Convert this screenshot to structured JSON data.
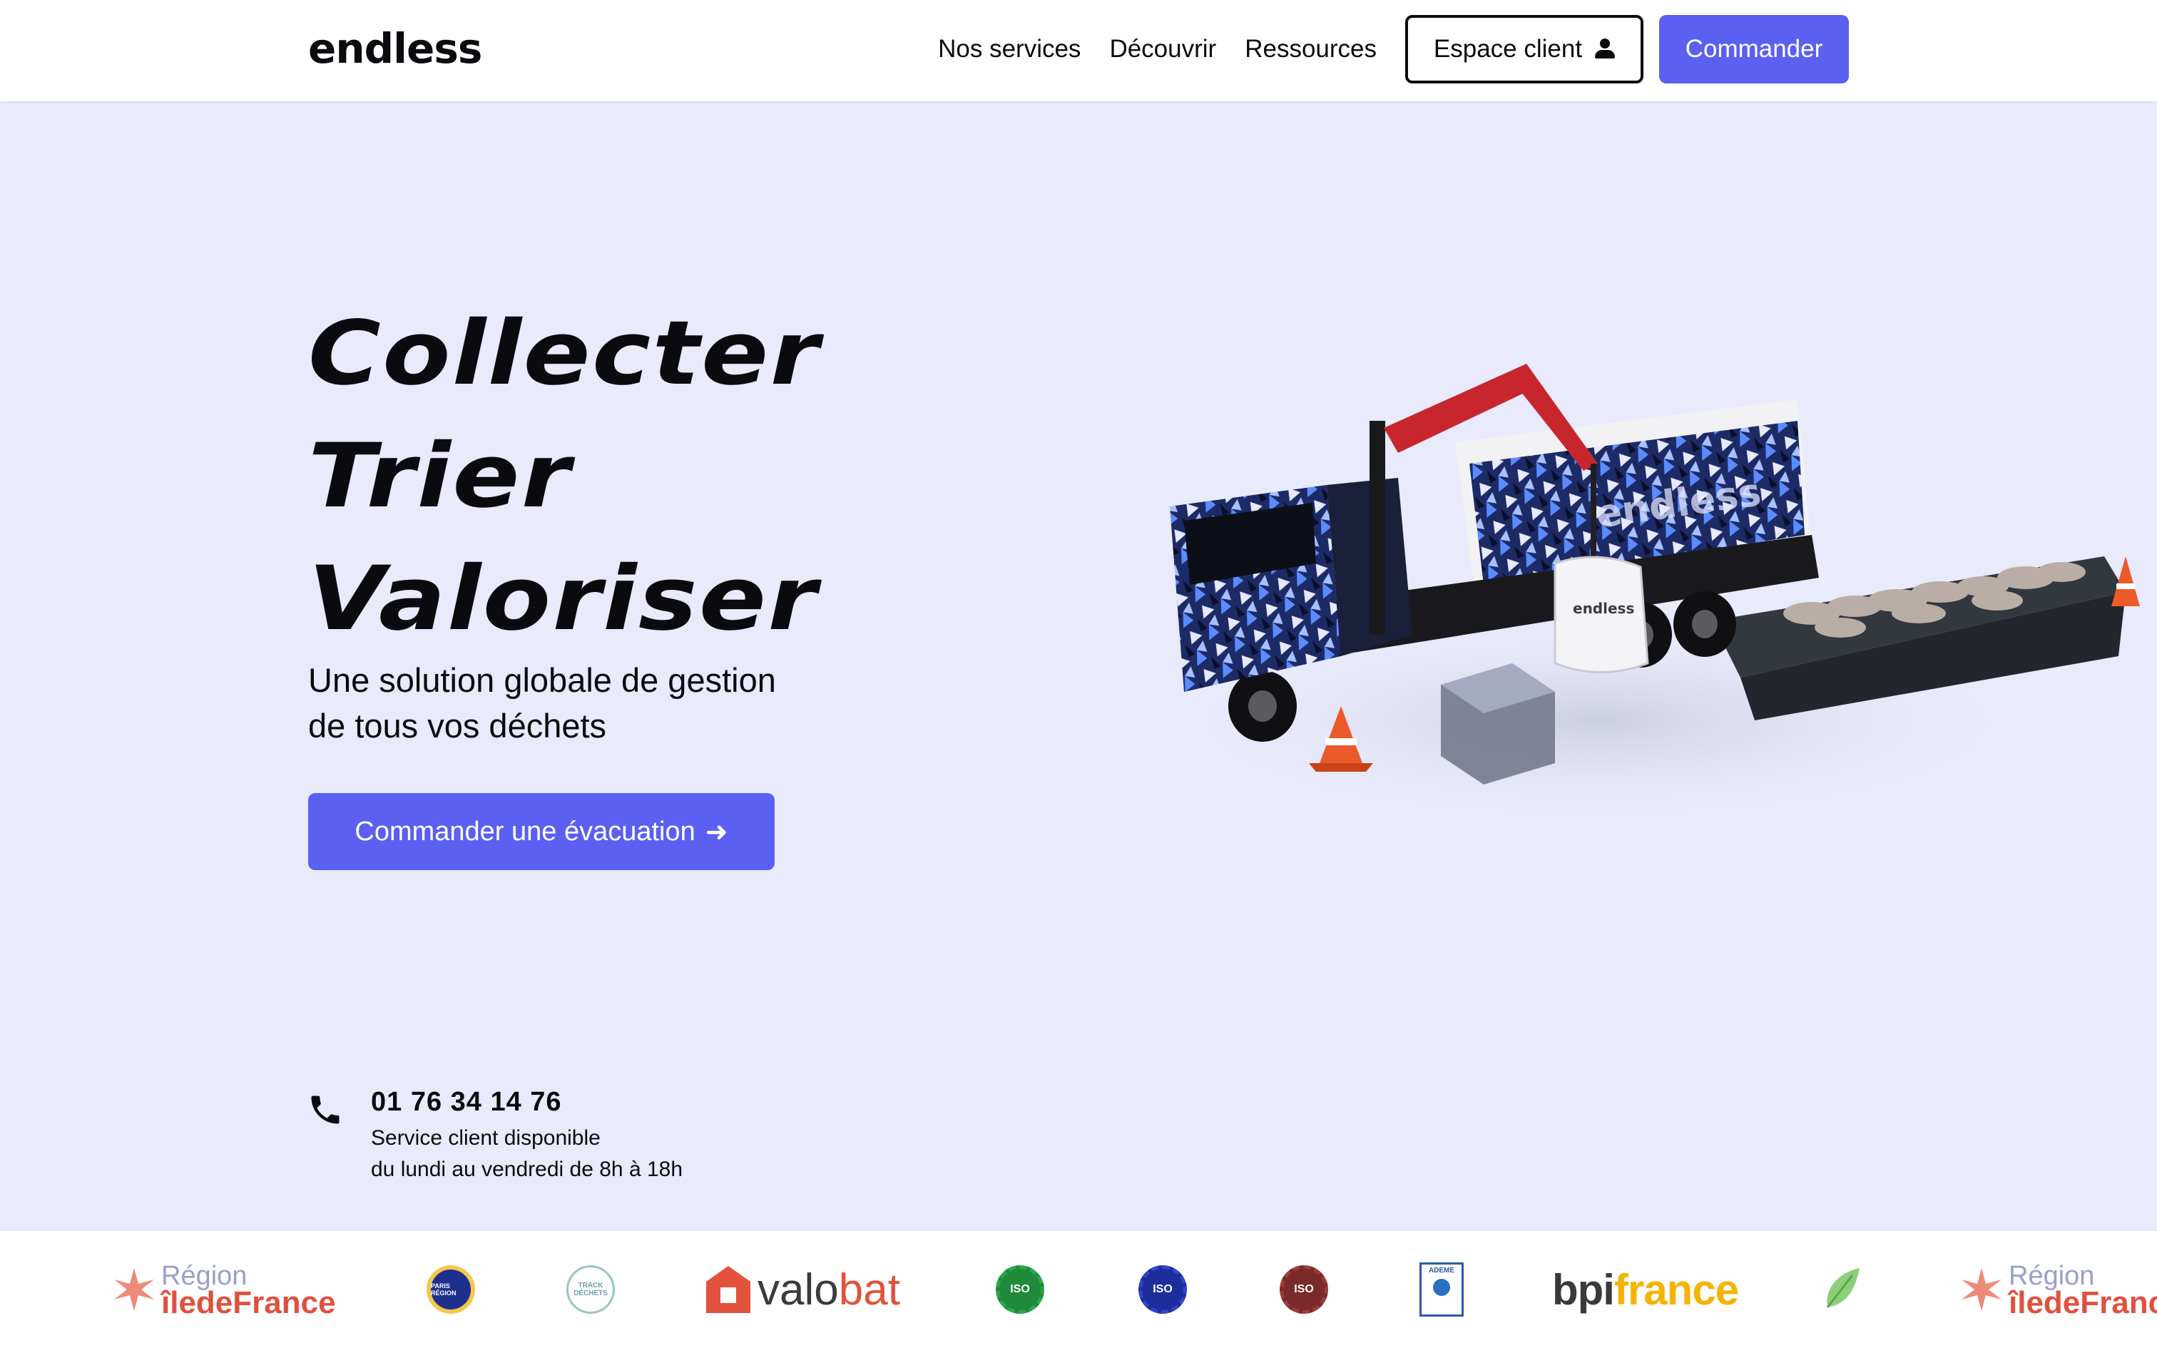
{
  "header": {
    "logo": "endless",
    "nav": [
      "Nos services",
      "Découvrir",
      "Ressources"
    ],
    "client_button": "Espace client",
    "order_button": "Commander"
  },
  "hero": {
    "title_lines": [
      "Collecter",
      "Trier",
      "Valoriser"
    ],
    "subtitle_line1": "Une solution globale de gestion",
    "subtitle_line2": "de tous vos déchets",
    "cta_label": "Commander une évacuation"
  },
  "truck": {
    "brand_text": "endless",
    "bag_text": "endless"
  },
  "contact": {
    "phone": "01 76 34 14 76",
    "note_line1": "Service client disponible",
    "note_line2": "du lundi au vendredi de 8h à 18h"
  },
  "partners": {
    "region_l1": "Région",
    "region_l2": "îledeFrance",
    "badge_iso": "ISO",
    "track_label": "TRACK DÉCHETS",
    "paris_region": "PARIS RÉGION",
    "valobat_1": "valo",
    "valobat_2": "bat",
    "ademe": "ADEME",
    "bpi_1": "bpi",
    "bpi_2": "france"
  },
  "colors": {
    "accent": "#5b5ff2",
    "hero_bg": "#e9eafb",
    "text": "#0b0b0f"
  }
}
